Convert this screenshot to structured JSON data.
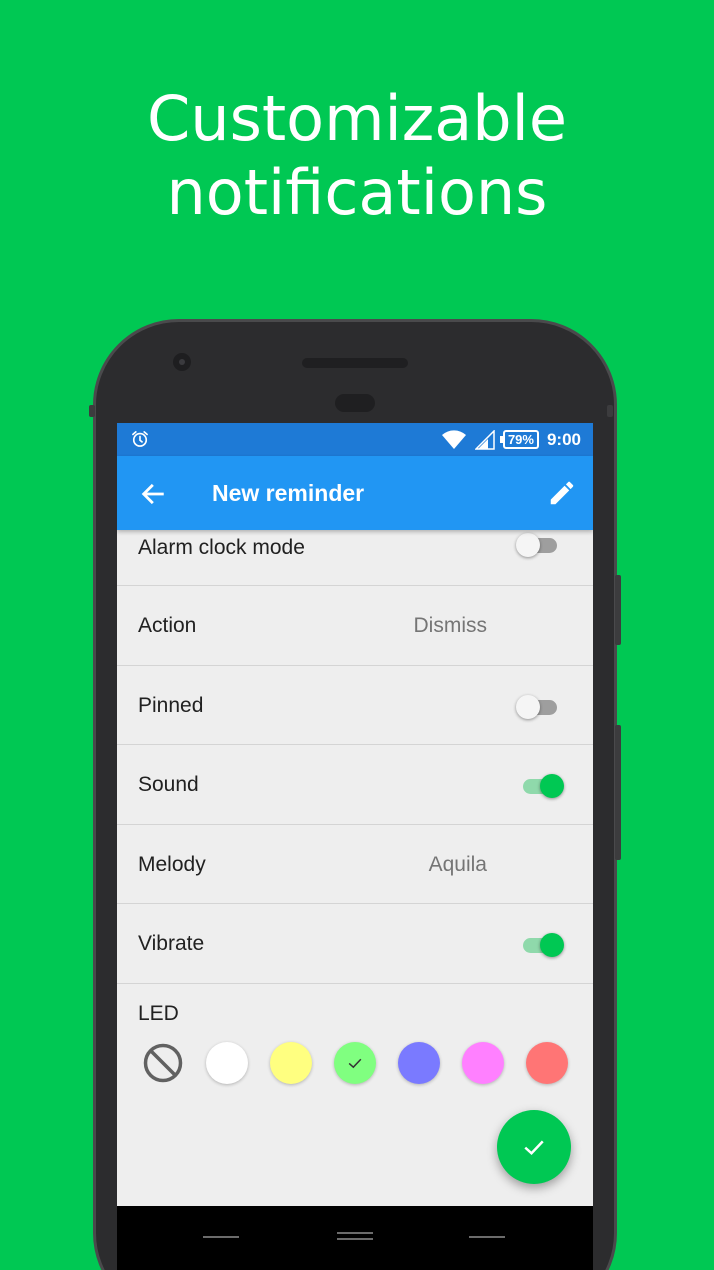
{
  "headline": {
    "line1": "Customizable",
    "line2": "notifications"
  },
  "statusbar": {
    "battery": "79%",
    "time": "9:00"
  },
  "appbar": {
    "title": "New reminder"
  },
  "rows": [
    {
      "label": "Alarm clock mode",
      "type": "switch",
      "on": false
    },
    {
      "label": "Action",
      "type": "value",
      "value": "Dismiss"
    },
    {
      "label": "Pinned",
      "type": "switch",
      "on": false
    },
    {
      "label": "Sound",
      "type": "switch",
      "on": true
    },
    {
      "label": "Melody",
      "type": "value",
      "value": "Aquila"
    },
    {
      "label": "Vibrate",
      "type": "switch",
      "on": true
    }
  ],
  "led": {
    "label": "LED",
    "colors": [
      {
        "name": "none",
        "hex": "none",
        "selected": false
      },
      {
        "name": "white",
        "hex": "#ffffff",
        "selected": false
      },
      {
        "name": "yellow",
        "hex": "#ffff80",
        "selected": false
      },
      {
        "name": "green",
        "hex": "#80ff80",
        "selected": true
      },
      {
        "name": "blue",
        "hex": "#7a7aff",
        "selected": false
      },
      {
        "name": "pink",
        "hex": "#ff80ff",
        "selected": false
      },
      {
        "name": "red",
        "hex": "#ff7575",
        "selected": false
      }
    ]
  },
  "colors": {
    "background": "#00c853",
    "statusbar": "#1e7ad6",
    "appbar": "#2196f3",
    "accent": "#00c853"
  },
  "icons": {
    "back": "arrow-back-icon",
    "edit": "pencil-icon",
    "fab": "check-icon",
    "alarm": "alarm-icon"
  }
}
